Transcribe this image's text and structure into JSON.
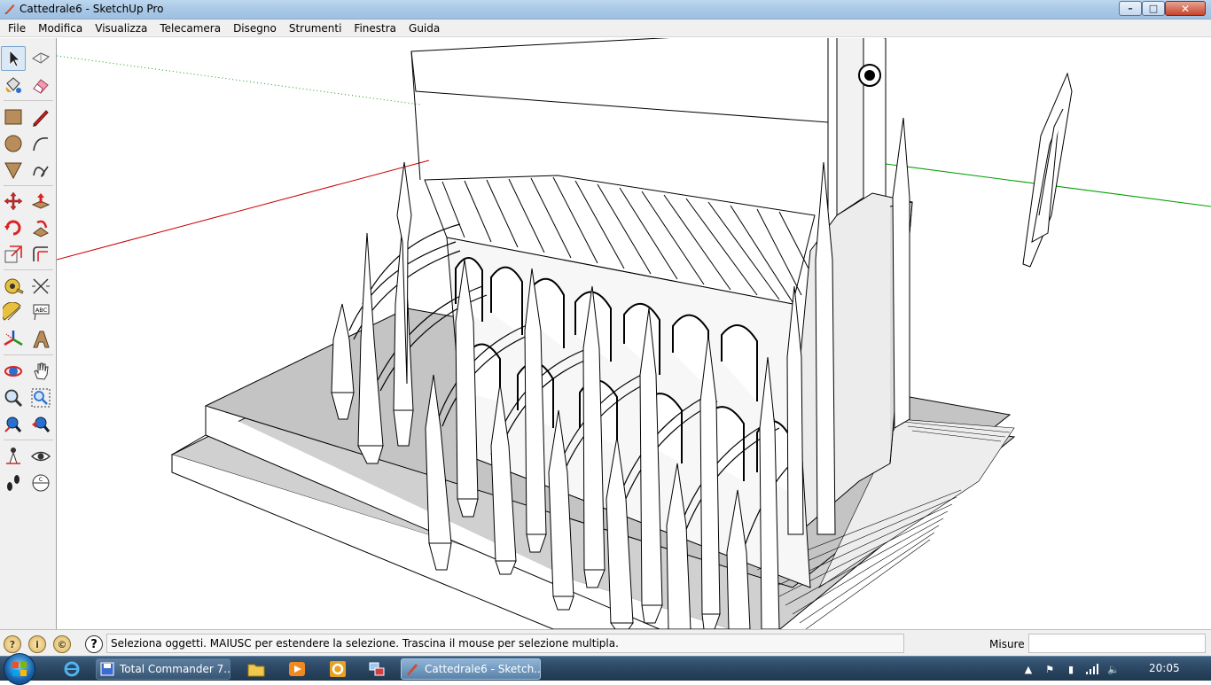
{
  "window": {
    "title": "Cattedrale6 - SketchUp Pro",
    "buttons": {
      "minimize": "–",
      "maximize": "□",
      "close": "✕"
    }
  },
  "menu": {
    "items": [
      "File",
      "Modifica",
      "Visualizza",
      "Telecamera",
      "Disegno",
      "Strumenti",
      "Finestra",
      "Guida"
    ]
  },
  "toolbar": {
    "tools": [
      {
        "name": "select-icon"
      },
      {
        "name": "make-component-icon"
      },
      {
        "name": "paint-bucket-icon"
      },
      {
        "name": "eraser-icon"
      },
      {
        "name": "rectangle-icon"
      },
      {
        "name": "line-icon"
      },
      {
        "name": "circle-icon"
      },
      {
        "name": "arc-icon"
      },
      {
        "name": "polygon-icon"
      },
      {
        "name": "freehand-icon"
      },
      {
        "name": "move-icon"
      },
      {
        "name": "push-pull-icon"
      },
      {
        "name": "rotate-icon"
      },
      {
        "name": "follow-me-icon"
      },
      {
        "name": "scale-icon"
      },
      {
        "name": "offset-icon"
      },
      {
        "name": "tape-measure-icon"
      },
      {
        "name": "dimension-icon"
      },
      {
        "name": "protractor-icon"
      },
      {
        "name": "text-icon"
      },
      {
        "name": "axes-icon"
      },
      {
        "name": "3d-text-icon"
      },
      {
        "name": "orbit-icon"
      },
      {
        "name": "pan-icon"
      },
      {
        "name": "zoom-icon"
      },
      {
        "name": "zoom-window-icon"
      },
      {
        "name": "zoom-extents-icon"
      },
      {
        "name": "previous-view-icon"
      },
      {
        "name": "position-camera-icon"
      },
      {
        "name": "look-around-icon"
      },
      {
        "name": "walk-icon"
      },
      {
        "name": "section-plane-icon"
      }
    ],
    "dimension_text": "ABC",
    "section_text": "C"
  },
  "status": {
    "text": "Seleziona oggetti. MAIUSC per estendere la selezione. Trascina il mouse per selezione multipla.",
    "measure_label": "Misure",
    "measure_value": "",
    "help_glyph": "?"
  },
  "taskbar": {
    "buttons": [
      {
        "label": "Total Commander 7...."
      },
      {
        "label": "Cattedrale6 - Sketch..."
      }
    ],
    "clock": "20:05"
  },
  "colors": {
    "red_axis": "#cc0000",
    "green_axis": "#00a000",
    "model_face": "#ffffff",
    "model_shadow": "#c8c8c8",
    "model_edge": "#000000"
  }
}
